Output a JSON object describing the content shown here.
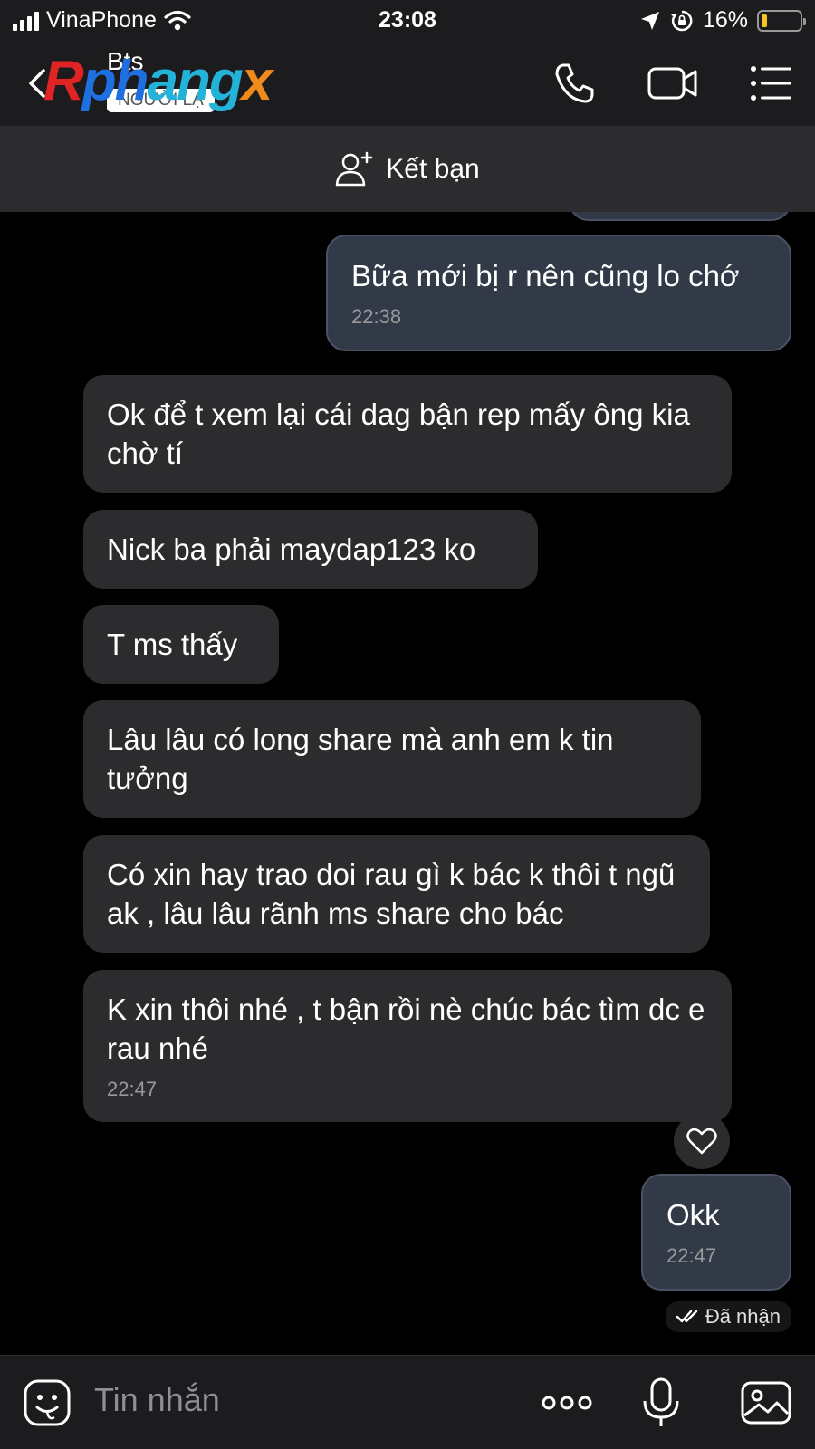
{
  "status_bar": {
    "carrier": "VinaPhone",
    "time": "23:08",
    "battery": "16%",
    "battery_level": 0.16
  },
  "header": {
    "contact_name": "Bts",
    "badge": "NGƯỜI LẠ",
    "watermark": [
      "R",
      "ph",
      "ang",
      "x"
    ],
    "icons": [
      "back-icon",
      "phone-icon",
      "video-call-icon",
      "menu-icon"
    ]
  },
  "add_friend": {
    "label": "Kết bạn"
  },
  "messages": [
    {
      "side": "out",
      "text": "Bữa mới bị r nên cũng lo chớ",
      "time": "22:38"
    },
    {
      "side": "in",
      "text": "Ok để t xem lại cái dag bận rep mấy ông kia chờ tí"
    },
    {
      "side": "in",
      "text": "Nick ba phải maydap123 ko"
    },
    {
      "side": "in",
      "text": "T ms thấy"
    },
    {
      "side": "in",
      "text": "Lâu lâu có long share mà anh em k tin tưởng"
    },
    {
      "side": "in",
      "text": "Có xin hay trao doi rau gì k bác k thôi t ngũ ak , lâu lâu rãnh ms share cho bác"
    },
    {
      "side": "in",
      "text": "K xin thôi nhé , t bận rồi nè chúc bác tìm dc e rau nhé",
      "time": "22:47"
    },
    {
      "side": "out",
      "text": "Okk",
      "time": "22:47"
    }
  ],
  "delivery_status": "Đã nhận",
  "composer": {
    "placeholder": "Tin nhắn",
    "icons": [
      "emoji-icon",
      "more-icon",
      "microphone-icon",
      "image-icon"
    ]
  },
  "colors": {
    "incoming_bubble": "#2c2c2e",
    "outgoing_bubble": "#323a48",
    "background": "#000000"
  }
}
